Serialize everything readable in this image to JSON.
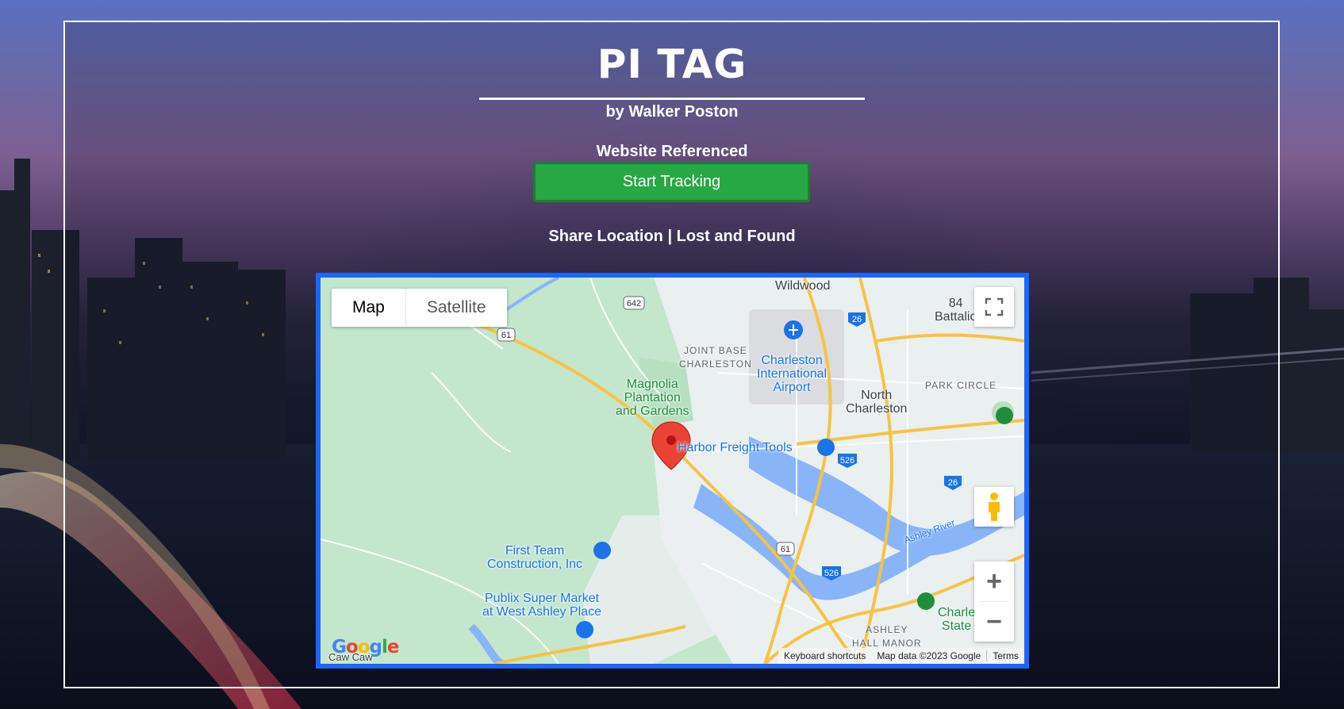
{
  "header": {
    "title": "PI TAG",
    "byline": "by Walker Poston",
    "reference_label": "Website Referenced"
  },
  "start_button": {
    "label": "Start Tracking",
    "color": "#28a745"
  },
  "links": {
    "share": "Share Location",
    "separator": " | ",
    "lost_found": "Lost and Found"
  },
  "map": {
    "border_color": "#1a66ff",
    "type_controls": [
      "Map",
      "Satellite"
    ],
    "selected_type": "Map",
    "labels": {
      "wildwood": "Wildwood",
      "joint_base": "JOINT BASE\nCHARLESTON",
      "airport": "Charleston\nInternational\nAirport",
      "magnolia": "Magnolia\nPlantation\nand Gardens",
      "north_charleston": "North\nCharleston",
      "park_circle": "PARK CIRCLE",
      "harbor_freight": "Harbor Freight Tools",
      "first_team": "First Team\nConstruction, Inc",
      "publix": "Publix Super Market\nat West Ashley Place",
      "ashley_river": "Ashley River",
      "ashley_hall": "ASHLEY\nHALL MANOR",
      "charles_state": "Charle\nState",
      "battalion": "84\nBattalio",
      "caw_caw": "Caw Caw"
    },
    "route_shields": [
      "642",
      "61",
      "26",
      "526",
      "526",
      "26",
      "61",
      "526"
    ],
    "attribution": {
      "shortcuts": "Keyboard shortcuts",
      "data": "Map data ©2023 Google",
      "terms": "Terms"
    },
    "logo": "Google"
  }
}
